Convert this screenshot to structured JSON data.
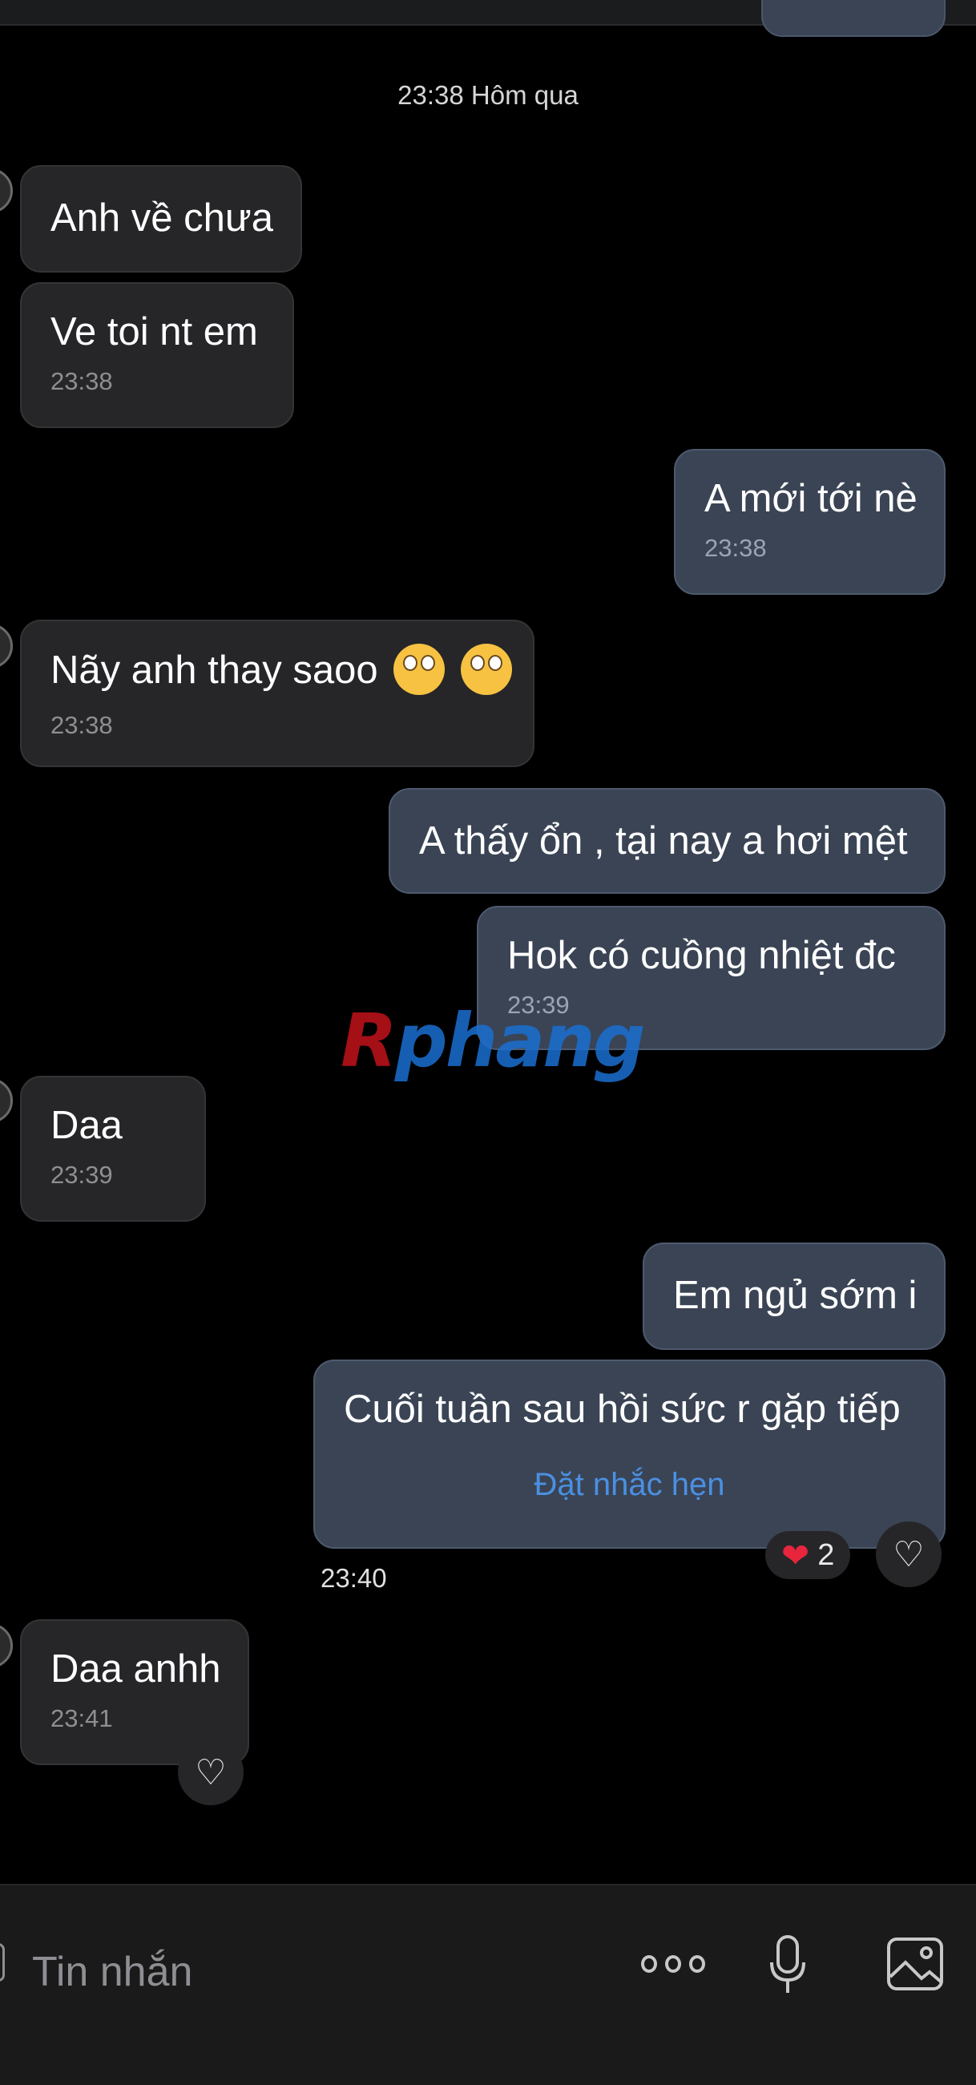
{
  "conversation": {
    "date_separator": "23:38 Hôm qua",
    "messages": [
      {
        "direction": "in",
        "text": "Anh về chưa",
        "time": ""
      },
      {
        "direction": "in",
        "text": "Ve toi nt em",
        "time": "23:38"
      },
      {
        "direction": "out",
        "text": "A mới tới nè",
        "time": "23:38"
      },
      {
        "direction": "in",
        "text": "Nãy anh thay saoo",
        "emoji": [
          "face-with-rolling-eyes",
          "face-with-rolling-eyes"
        ],
        "time": "23:38"
      },
      {
        "direction": "out",
        "text": "A thấy ổn , tại nay a hơi mệt",
        "time": ""
      },
      {
        "direction": "out",
        "text": "Hok có cuồng nhiệt đc",
        "time": "23:39"
      },
      {
        "direction": "in",
        "text": "Daa",
        "time": "23:39"
      },
      {
        "direction": "out",
        "text": "Em ngủ sớm i",
        "time": ""
      },
      {
        "direction": "out",
        "text": "Cuối tuần sau hồi sức r gặp tiếp",
        "action": "Đặt nhắc hẹn",
        "time": "",
        "reaction_count": "2",
        "timestamp_below": "23:40"
      },
      {
        "direction": "in",
        "text": "Daa anhh",
        "time": "23:41"
      }
    ]
  },
  "watermark": {
    "part1": "R",
    "part2": "phang"
  },
  "composer": {
    "placeholder": "Tin nhắn",
    "icons": [
      "more-options-icon",
      "microphone-icon",
      "image-icon"
    ]
  },
  "colors": {
    "background": "#000000",
    "incoming_bubble": "#262628",
    "outgoing_bubble": "#3a4455",
    "link": "#4a90e2",
    "heart": "#e8253d"
  }
}
